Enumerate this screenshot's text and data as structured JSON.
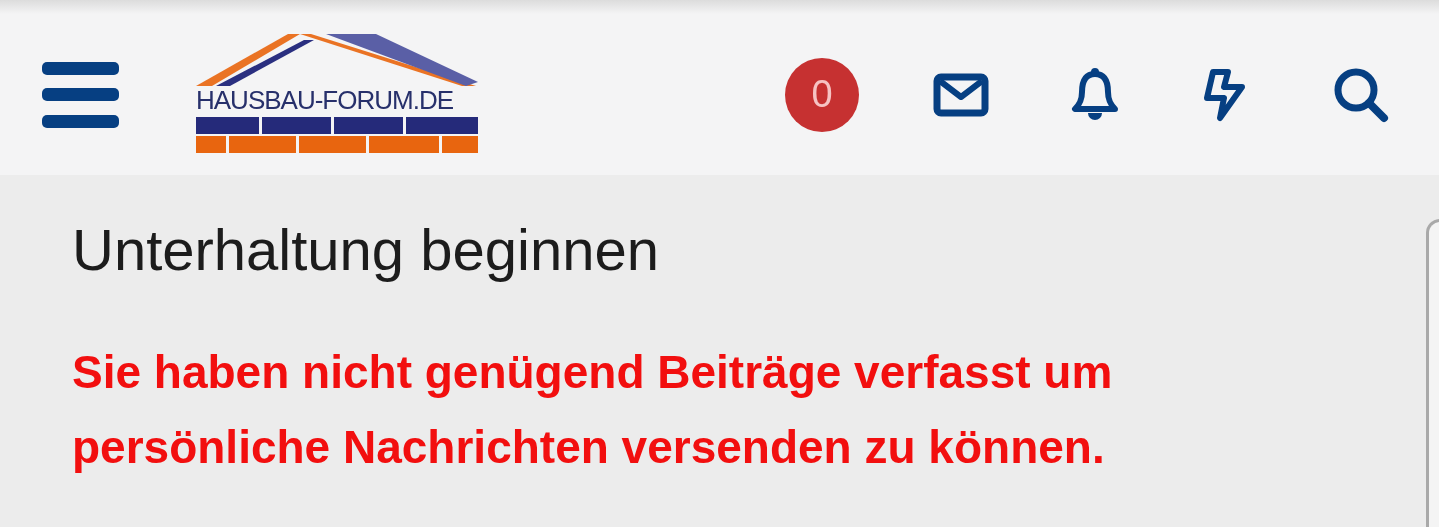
{
  "header": {
    "logo_text": "HAUSBAU-FORUM.DE",
    "badge_count": "0"
  },
  "page": {
    "title": "Unterhaltung beginnen",
    "error_message": "Sie haben nicht genügend Beiträge verfasst um persönliche Nachrichten versenden zu können."
  }
}
